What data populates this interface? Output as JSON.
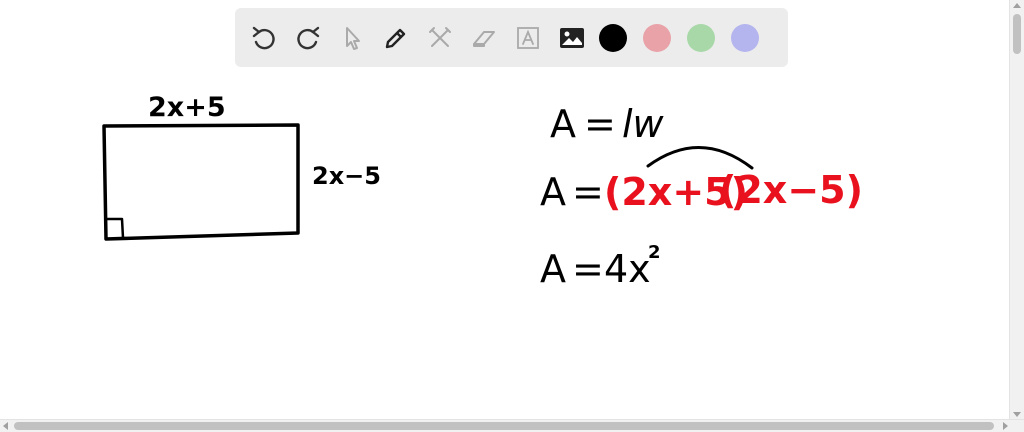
{
  "toolbar": {
    "tools": [
      {
        "icon": "undo-icon"
      },
      {
        "icon": "redo-icon"
      },
      {
        "icon": "pointer-icon"
      },
      {
        "icon": "pen-icon"
      },
      {
        "icon": "tools-icon"
      },
      {
        "icon": "eraser-icon"
      },
      {
        "icon": "text-box-icon"
      },
      {
        "icon": "image-icon"
      }
    ],
    "colors": [
      "#000000",
      "#e8a2a8",
      "#a8d8a8",
      "#b4b4ee"
    ],
    "selected_color": "#000000"
  },
  "canvas": {
    "rectangle_top_label": "2x+5",
    "rectangle_side_label": "2x−5",
    "equation_1": {
      "lhs": "A",
      "eq": "=",
      "rhs": "lw"
    },
    "equation_2": {
      "lhs": "A",
      "eq": "=",
      "factor_1": "(2x+5)",
      "factor_2": "(2x−5)"
    },
    "equation_3": {
      "lhs": "A",
      "eq": "=",
      "rhs": "4x",
      "exponent": "2"
    },
    "ink_colors": {
      "black": "#000000",
      "red": "#e8111d"
    }
  }
}
